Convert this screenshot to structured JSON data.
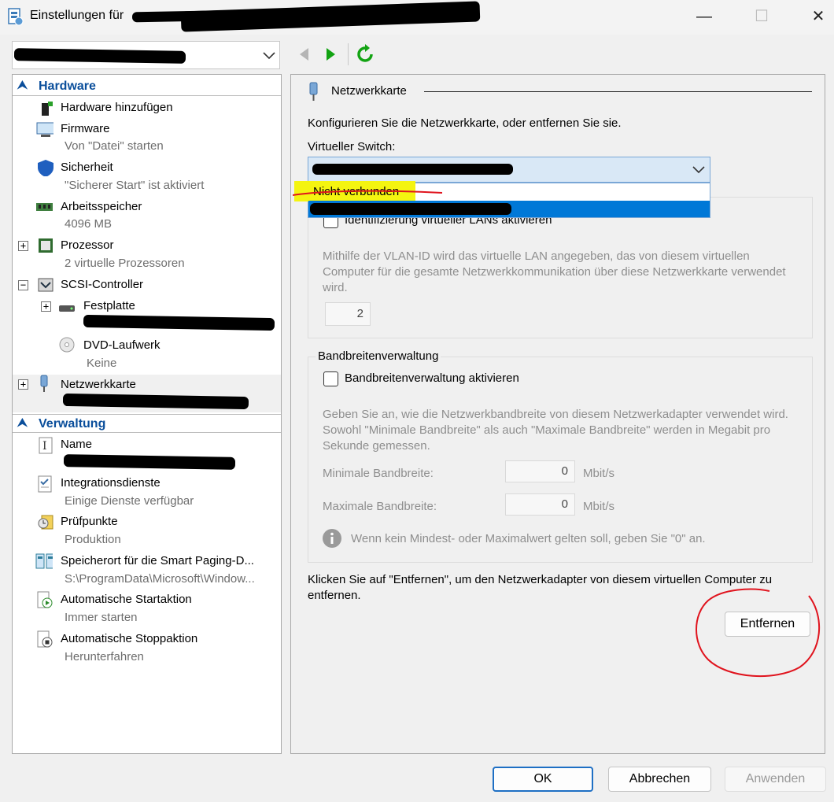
{
  "window": {
    "title": "Einstellungen für",
    "minimize": "—",
    "maximize": "☐",
    "close": "✕"
  },
  "vm_selector": {
    "chevron": "﹀"
  },
  "tree": {
    "hardware_header": "Hardware",
    "items": {
      "add_hardware": "Hardware hinzufügen",
      "firmware": "Firmware",
      "firmware_sub": "Von \"Datei\" starten",
      "security": "Sicherheit",
      "security_sub": "\"Sicherer Start\" ist aktiviert",
      "memory": "Arbeitsspeicher",
      "memory_sub": "4096 MB",
      "processor": "Prozessor",
      "processor_sub": "2 virtuelle Prozessoren",
      "scsi": "SCSI-Controller",
      "harddisk": "Festplatte",
      "dvd": "DVD-Laufwerk",
      "dvd_sub": "Keine",
      "network": "Netzwerkkarte"
    },
    "management_header": "Verwaltung",
    "mgmt": {
      "name": "Name",
      "integration": "Integrationsdienste",
      "integration_sub": "Einige Dienste verfügbar",
      "checkpoints": "Prüfpunkte",
      "checkpoints_sub": "Produktion",
      "smartpaging": "Speicherort für die Smart Paging-D...",
      "smartpaging_sub": "S:\\ProgramData\\Microsoft\\Window...",
      "autostart": "Automatische Startaktion",
      "autostart_sub": "Immer starten",
      "autostop": "Automatische Stoppaktion",
      "autostop_sub": "Herunterfahren"
    }
  },
  "panel": {
    "heading": "Netzwerkkarte",
    "intro": "Konfigurieren Sie die Netzwerkkarte, oder entfernen Sie sie.",
    "switch_label": "Virtueller Switch:",
    "dropdown_option_1": "Nicht verbunden",
    "vlan_checkbox": "Identifizierung virtueller LANs aktivieren",
    "vlan_desc": "Mithilfe der VLAN-ID wird das virtuelle LAN angegeben, das von diesem virtuellen Computer für die gesamte Netzwerkkommunikation über diese Netzwerkkarte verwendet wird.",
    "vlan_id": "2",
    "bandwidth_group": "Bandbreitenverwaltung",
    "bandwidth_checkbox": "Bandbreitenverwaltung aktivieren",
    "bandwidth_desc": "Geben Sie an, wie die Netzwerkbandbreite von diesem Netzwerkadapter verwendet wird. Sowohl \"Minimale Bandbreite\" als auch \"Maximale Bandbreite\" werden in Megabit pro Sekunde gemessen.",
    "min_label": "Minimale Bandbreite:",
    "min_value": "0",
    "max_label": "Maximale Bandbreite:",
    "max_value": "0",
    "unit": "Mbit/s",
    "info_text": "Wenn kein Mindest- oder Maximalwert gelten soll, geben Sie \"0\" an.",
    "remove_desc": "Klicken Sie auf \"Entfernen\", um den Netzwerkadapter von diesem virtuellen Computer zu entfernen.",
    "remove_button": "Entfernen"
  },
  "footer": {
    "ok": "OK",
    "cancel": "Abbrechen",
    "apply": "Anwenden"
  },
  "colors": {
    "accent": "#0a4e9b",
    "selected": "#0078d7",
    "highlight": "#f4f410",
    "annotation": "#e0141e"
  }
}
